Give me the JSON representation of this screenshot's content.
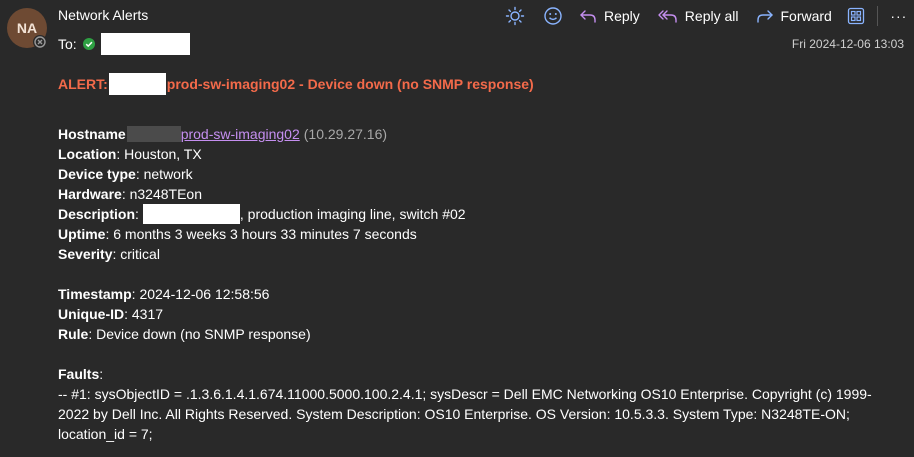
{
  "sender": {
    "initials": "NA",
    "name": "Network Alerts",
    "to_label": "To:"
  },
  "toolbar": {
    "reply_label": "Reply",
    "reply_all_label": "Reply all",
    "forward_label": "Forward",
    "more_label": "···"
  },
  "date": "Fri 2024-12-06 13:03",
  "colors": {
    "alert_title": "#f36a4a",
    "link": "#c58ff0",
    "icon_accent": "#8ab4ff",
    "presence_green": "#2ea043"
  },
  "alert": {
    "prefix": "ALERT:",
    "title": "prod-sw-imaging02 - Device down (no SNMP response)"
  },
  "fields": {
    "hostname_label": "Hostname",
    "hostname_link": "prod-sw-imaging02",
    "hostname_ip": "(10.29.27.16)",
    "location_label": "Location",
    "location_value": ": Houston, TX",
    "device_type_label": "Device type",
    "device_type_value": ": network",
    "hardware_label": "Hardware",
    "hardware_value": ": n3248TEon",
    "description_label": "Description",
    "description_sep": ":",
    "description_value": ", production imaging line, switch #02",
    "uptime_label": "Uptime",
    "uptime_value": ": 6 months 3 weeks 3 hours 33 minutes 7 seconds",
    "severity_label": "Severity",
    "severity_value": ": critical",
    "timestamp_label": "Timestamp",
    "timestamp_value": ": 2024-12-06 12:58:56",
    "unique_id_label": "Unique-ID",
    "unique_id_value": ": 4317",
    "rule_label": "Rule",
    "rule_value": ": Device down (no SNMP response)",
    "faults_label": "Faults",
    "faults_colon": ":",
    "faults_text": "-- #1: sysObjectID = .1.3.6.1.4.1.674.11000.5000.100.2.4.1; sysDescr = Dell EMC Networking OS10 Enterprise. Copyright (c) 1999-2022 by Dell Inc. All Rights Reserved. System Description: OS10 Enterprise. OS Version: 10.5.3.3. System Type: N3248TE-ON; location_id = 7;"
  }
}
